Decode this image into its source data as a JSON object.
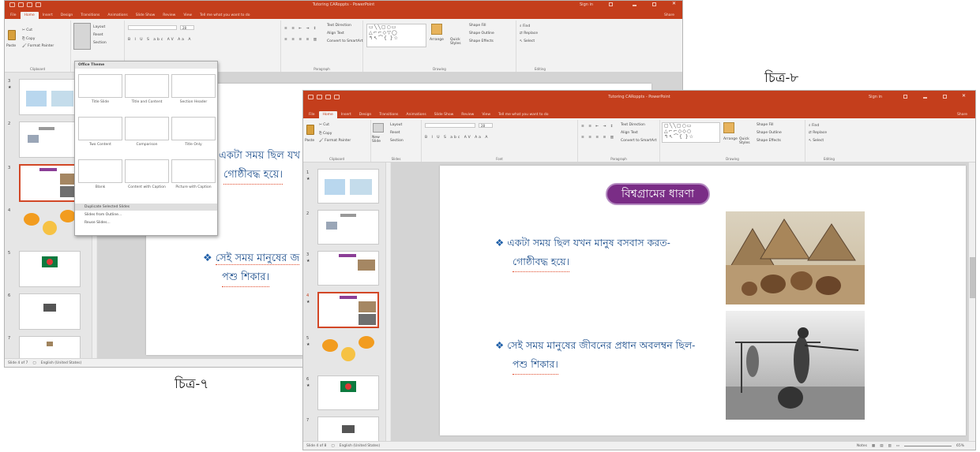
{
  "captions": {
    "fig7": "চিত্র-৭",
    "fig8": "চিত্র-৮"
  },
  "app": {
    "title": "Tutoring CARoppts - PowerPoint",
    "sign_in": "Sign in",
    "tabs": [
      "File",
      "Home",
      "Insert",
      "Design",
      "Transitions",
      "Animations",
      "Slide Show",
      "Review",
      "View"
    ],
    "active_tab": "Home",
    "tell_me": "Tell me what you want to do",
    "share": "Share"
  },
  "ribbon": {
    "cut": "Cut",
    "copy": "Copy",
    "format_painter": "Format Painter",
    "paste": "Paste",
    "clipboard": "Clipboard",
    "new_slide": "New Slide",
    "layout": "Layout",
    "reset": "Reset",
    "section": "Section",
    "slides": "Slides",
    "font": "Font",
    "font_size": "28",
    "paragraph": "Paragraph",
    "text_direction": "Text Direction",
    "align_text": "Align Text",
    "convert_smartart": "Convert to SmartArt",
    "arrange": "Arrange",
    "quick_styles": "Quick Styles",
    "shape_fill": "Shape Fill",
    "shape_outline": "Shape Outline",
    "shape_effects": "Shape Effects",
    "drawing": "Drawing",
    "find": "Find",
    "replace": "Replace",
    "select": "Select",
    "editing": "Editing"
  },
  "layout_menu": {
    "header": "Office Theme",
    "layouts": [
      "Title Slide",
      "Title and Content",
      "Section Header",
      "Two Content",
      "Comparison",
      "Title Only",
      "Blank",
      "Content with Caption",
      "Picture with Caption"
    ],
    "items": [
      "Duplicate Selected Slides",
      "Slides from Outline...",
      "Reuse Slides..."
    ]
  },
  "fig7": {
    "slide_numbers": [
      "3",
      "2",
      "3",
      "4",
      "5",
      "6",
      "7"
    ],
    "slide_text": [
      "একটা সময় ছিল যখ",
      "গোষ্ঠীবদ্ধ হয়ে।",
      "সেই সময় মানুষের জ",
      "পশু শিকার।"
    ],
    "status": "Slide 4 of 7",
    "language": "English (United States)"
  },
  "fig8": {
    "slide_numbers": [
      "1",
      "2",
      "3",
      "4",
      "5",
      "6",
      "7"
    ],
    "slide_title": "বিশ্বগ্রামের ধারণা",
    "bullet1_line1": "একটা সময় ছিল যখন মানুষ বসবাস করত-",
    "bullet1_line2": "গোষ্ঠীবদ্ধ হয়ে।",
    "bullet2_line1": "সেই সময় মানুষের জীবনের প্রধান অবলম্বন ছিল-",
    "bullet2_line2": "পশু শিকার।",
    "status": "Slide 4 of 8",
    "language": "English (United States)",
    "notes": "Notes",
    "zoom": "65%"
  },
  "colors": {
    "accent": "#c43e1c",
    "pill": "#7a2d86",
    "bullet_text": "#1c4e8c"
  },
  "icons": [
    "save-icon",
    "undo-icon",
    "redo-icon",
    "start-from-beginning-icon",
    "cut-icon",
    "copy-icon",
    "format-painter-icon",
    "paste-icon",
    "find-icon",
    "diamond-bullet-icon"
  ]
}
